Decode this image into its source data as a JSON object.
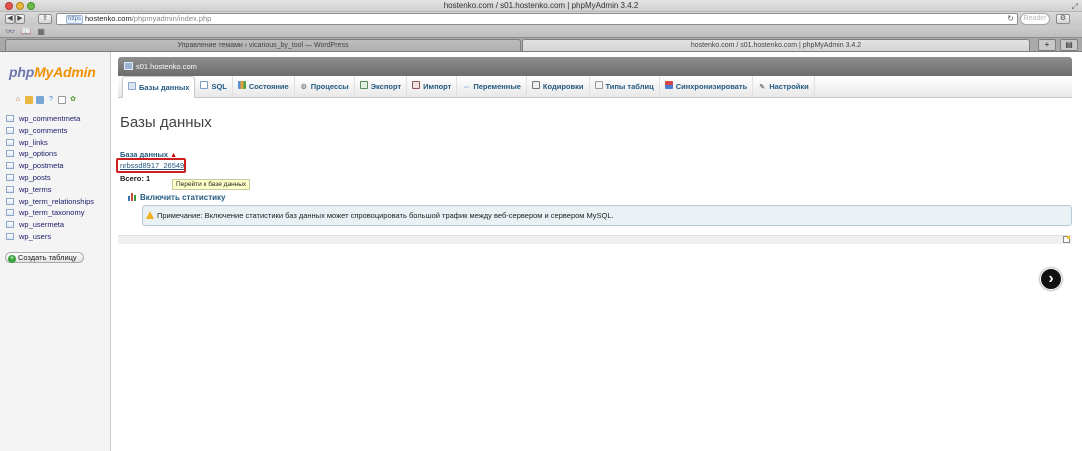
{
  "browser": {
    "window_title": "hostenko.com / s01.hostenko.com | phpMyAdmin 3.4.2",
    "url_scheme_badge": "https",
    "url_host": "hostenko.com",
    "url_path": "/phpmyadmin/index.php",
    "reader_label": "Reader",
    "tabs": [
      {
        "label": "Управление темами ‹ vicarious_by_tool — WordPress",
        "active": false
      },
      {
        "label": "hostenko.com / s01.hostenko.com | phpMyAdmin 3.4.2",
        "active": true
      }
    ]
  },
  "sidebar": {
    "logo_php": "php",
    "logo_myadmin": "MyAdmin",
    "quick_icons": [
      "home-icon",
      "sql-query-icon",
      "query-window-icon",
      "docs-icon",
      "reload-icon",
      "settings-icon"
    ],
    "tables": [
      "wp_commentmeta",
      "wp_comments",
      "wp_links",
      "wp_options",
      "wp_postmeta",
      "wp_posts",
      "wp_terms",
      "wp_term_relationships",
      "wp_term_taxonomy",
      "wp_usermeta",
      "wp_users"
    ],
    "create_table_label": "Создать таблицу"
  },
  "server": {
    "name": "s01.hostenko.com"
  },
  "menu": {
    "tabs": [
      {
        "label": "Базы данных",
        "icon": "database-icon",
        "active": true
      },
      {
        "label": "SQL",
        "icon": "sql-icon",
        "active": false
      },
      {
        "label": "Состояние",
        "icon": "status-icon",
        "active": false
      },
      {
        "label": "Процессы",
        "icon": "processes-icon",
        "active": false
      },
      {
        "label": "Экспорт",
        "icon": "export-icon",
        "active": false
      },
      {
        "label": "Импорт",
        "icon": "import-icon",
        "active": false
      },
      {
        "label": "Переменные",
        "icon": "variables-icon",
        "active": false
      },
      {
        "label": "Кодировки",
        "icon": "charsets-icon",
        "active": false
      },
      {
        "label": "Типы таблиц",
        "icon": "engines-icon",
        "active": false
      },
      {
        "label": "Синхронизировать",
        "icon": "sync-icon",
        "active": false
      },
      {
        "label": "Настройки",
        "icon": "settings-icon",
        "active": false
      }
    ]
  },
  "main": {
    "page_title": "Базы данных",
    "column_header": "База данных",
    "databases": [
      "nrbssd8917_26549"
    ],
    "tooltip": "Перейти к базе данных",
    "total": "Всего: 1",
    "enable_stats": "Включить статистику",
    "notice": "Примечание: Включение статистики баз данных может спровоцировать большой трафик между веб-сервером и сервером MySQL."
  },
  "colors": {
    "accent_blue": "#235a81",
    "highlight_red": "#cc1f1f",
    "logo_orange": "#f29100"
  }
}
